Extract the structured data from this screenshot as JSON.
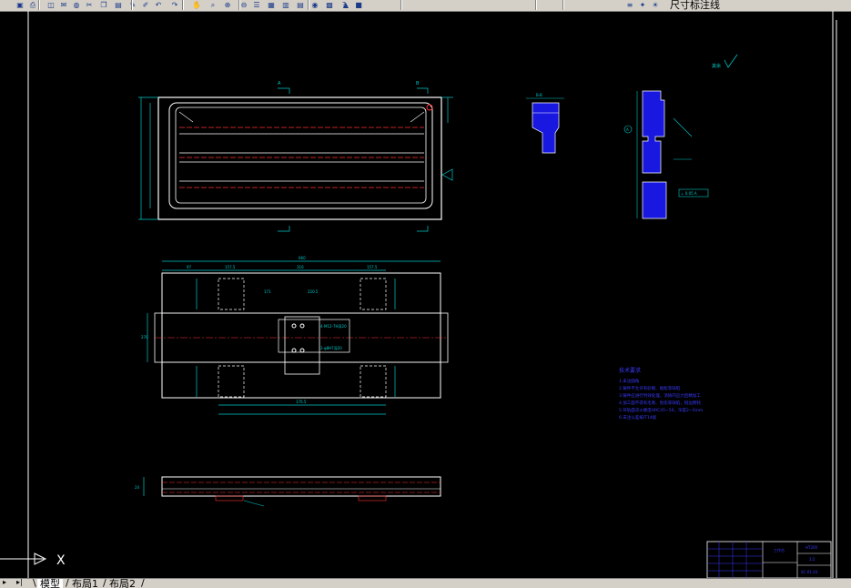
{
  "toolbar": {
    "icons": [
      "save-icon",
      "print-icon",
      "preview-icon",
      "publish-icon",
      "globe-icon",
      "cut-icon",
      "copy-icon",
      "paste-icon",
      "brush-icon",
      "match-prop-icon",
      "undo-icon",
      "redo-icon",
      "pan-icon",
      "zoom-realtime-icon",
      "zoom-window-icon",
      "zoom-prev-icon",
      "properties-icon",
      "design-center-icon",
      "tool-palette-icon",
      "sheet-set-icon",
      "markup-icon",
      "calc-icon",
      "help-icon",
      "layers-icon",
      "bulb-icon",
      "sun-icon",
      "lock-icon",
      "color-swatch-icon"
    ],
    "layer_name": "尺寸标注线"
  },
  "drawing": {
    "ucs_label": "X",
    "section_aa": "A",
    "section_bb": "B",
    "notes": [
      "技术要求",
      "1.未注圆角",
      "2.铸件不允许有砂眼、缩松等缺陷",
      "3.铸件应进行时效处理，消除内应力后精加工",
      "4.加工面不得有毛刺、划伤等缺陷，锐边倒钝",
      "5.导轨面淬火硬度HRC45~50，深度2~3mm",
      "6.未注公差按IT14级"
    ],
    "roughness_note": "其余",
    "datum_label": "A",
    "tolerance_frame": "⊥ 0.05 A",
    "dims": {
      "plan_total": "660",
      "plan_d1": "97",
      "plan_d2": "157.5",
      "plan_d3": "316",
      "plan_d4": "157.5",
      "plan_height": "270",
      "plan_bottom": "176.5",
      "plan_center": "171",
      "plan_slot": "220.5",
      "plan_hole": "4-M12-7H深20",
      "plan_hole2": "2-φ8H7深20",
      "front_h1": "24",
      "section_top": "B-B"
    },
    "title_block": {
      "drawing_title": "工作台",
      "material": "HT200",
      "scale": "1:2",
      "drawing_no": "SC-01-03"
    }
  },
  "layout_tabs": {
    "tabs": [
      "模型",
      "布局1",
      "布局2"
    ],
    "active": "模型"
  },
  "colors": {
    "background": "#000000",
    "outline": "#ffffff",
    "center_line": "#ff3030",
    "dimension": "#00c8c8",
    "notes": "#3a3aff",
    "hatch": "#1818e0"
  }
}
